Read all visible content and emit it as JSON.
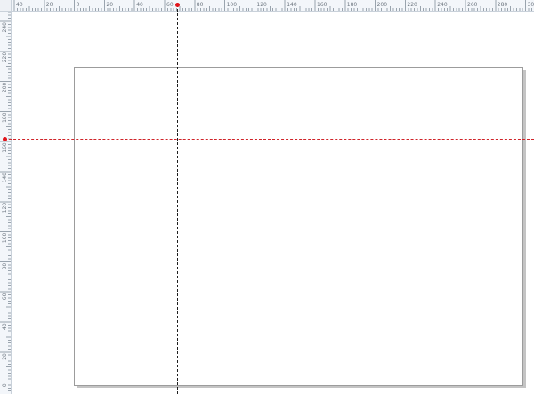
{
  "app": {
    "canvas_background": "#ffffff",
    "page_background": "#ffffff",
    "page_border_color": "#9c9c9c",
    "page_shadow_color": "#c4c4c4"
  },
  "rulers": {
    "horizontal": {
      "labels": [
        "40",
        "20",
        "0",
        "20",
        "40",
        "60",
        "80",
        "100",
        "120",
        "140",
        "160",
        "180",
        "200",
        "220",
        "240",
        "260",
        "280",
        "300"
      ]
    },
    "vertical": {
      "labels": [
        "240",
        "220",
        "200",
        "180",
        "160",
        "140",
        "120",
        "100",
        "80",
        "60",
        "40",
        "20",
        "0"
      ]
    },
    "background_color": "#f3f6fa",
    "tick_color": "#9aa4ae"
  },
  "guides": {
    "vertical": {
      "color": "#1d1d1d",
      "handle_color": "#e0141b"
    },
    "horizontal": {
      "color": "#d0242a",
      "handle_color": "#e0141b"
    }
  }
}
